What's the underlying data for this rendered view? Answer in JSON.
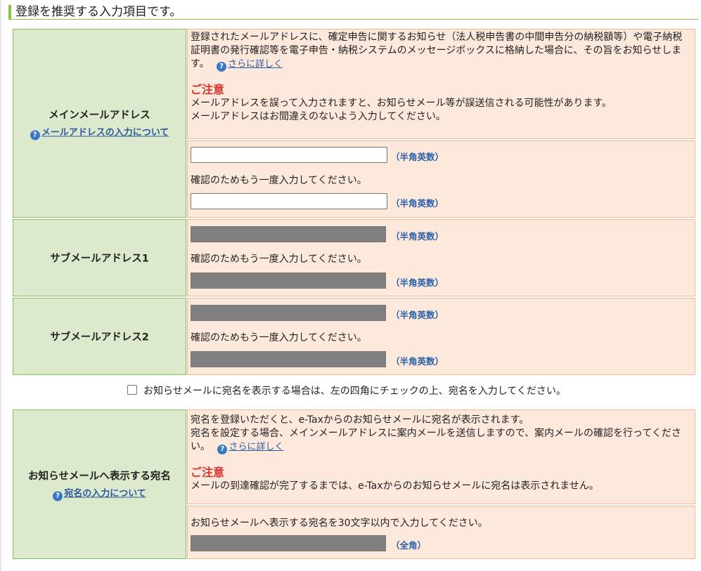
{
  "section": {
    "title": "登録を推奨する入力項目です。"
  },
  "main_email": {
    "label": "メインメールアドレス",
    "help_link": "メールアドレスの入力について",
    "description": "登録されたメールアドレスに、確定申告に関するお知らせ（法人税申告書の中間申告分の納税額等）や電子納税証明書の発行確認等を電子申告・納税システムのメッセージボックスに格納した場合に、その旨をお知らせします。",
    "more_link": "さらに詳しく",
    "caution_title": "ご注意",
    "caution_line1": "メールアドレスを誤って入力されますと、お知らせメール等が誤送信される可能性があります。",
    "caution_line2": "メールアドレスはお間違えのないよう入力してください。",
    "format_note": "（半角英数）",
    "confirm_text": "確認のためもう一度入力してください。",
    "value": "",
    "confirm_value": ""
  },
  "sub_email_1": {
    "label": "サブメールアドレス1",
    "format_note": "（半角英数）",
    "confirm_text": "確認のためもう一度入力してください。"
  },
  "sub_email_2": {
    "label": "サブメールアドレス2",
    "format_note": "（半角英数）",
    "confirm_text": "確認のためもう一度入力してください。"
  },
  "addressee_checkbox": {
    "label": "お知らせメールに宛名を表示する場合は、左の四角にチェックの上、宛名を入力してください。",
    "checked": false
  },
  "addressee": {
    "label": "お知らせメールへ表示する宛名",
    "help_link": "宛名の入力について",
    "description_line1": "宛名を登録いただくと、e-Taxからのお知らせメールに宛名が表示されます。",
    "description_line2": "宛名を設定する場合、メインメールアドレスに案内メールを送信しますので、案内メールの確認を行ってください。",
    "more_link": "さらに詳しく",
    "caution_title": "ご注意",
    "caution_line1": "メールの到達確認が完了するまでは、e-Taxからのお知らせメールに宛名は表示されません。",
    "input_instruction": "お知らせメールへ表示する宛名を30文字以内で入力してください。",
    "format_note": "（全角）"
  },
  "colors": {
    "label_bg": "#dde9cc",
    "content_bg": "#fde8dc",
    "caution": "#d9332b",
    "link": "#2c5aa0",
    "disabled_input": "#808080"
  }
}
